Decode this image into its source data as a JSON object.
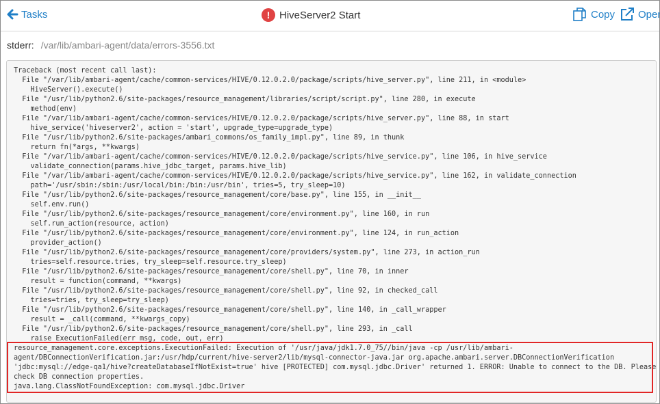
{
  "header": {
    "back_label": "Tasks",
    "title": "HiveServer2 Start",
    "copy_label": "Copy",
    "open_label": "Open"
  },
  "stderr": {
    "label": "stderr:",
    "path": "/var/lib/ambari-agent/data/errors-3556.txt"
  },
  "log_text": "Traceback (most recent call last):\n  File \"/var/lib/ambari-agent/cache/common-services/HIVE/0.12.0.2.0/package/scripts/hive_server.py\", line 211, in <module>\n    HiveServer().execute()\n  File \"/usr/lib/python2.6/site-packages/resource_management/libraries/script/script.py\", line 280, in execute\n    method(env)\n  File \"/var/lib/ambari-agent/cache/common-services/HIVE/0.12.0.2.0/package/scripts/hive_server.py\", line 88, in start\n    hive_service('hiveserver2', action = 'start', upgrade_type=upgrade_type)\n  File \"/usr/lib/python2.6/site-packages/ambari_commons/os_family_impl.py\", line 89, in thunk\n    return fn(*args, **kwargs)\n  File \"/var/lib/ambari-agent/cache/common-services/HIVE/0.12.0.2.0/package/scripts/hive_service.py\", line 106, in hive_service\n    validate_connection(params.hive_jdbc_target, params.hive_lib)\n  File \"/var/lib/ambari-agent/cache/common-services/HIVE/0.12.0.2.0/package/scripts/hive_service.py\", line 162, in validate_connection\n    path='/usr/sbin:/sbin:/usr/local/bin:/bin:/usr/bin', tries=5, try_sleep=10)\n  File \"/usr/lib/python2.6/site-packages/resource_management/core/base.py\", line 155, in __init__\n    self.env.run()\n  File \"/usr/lib/python2.6/site-packages/resource_management/core/environment.py\", line 160, in run\n    self.run_action(resource, action)\n  File \"/usr/lib/python2.6/site-packages/resource_management/core/environment.py\", line 124, in run_action\n    provider_action()\n  File \"/usr/lib/python2.6/site-packages/resource_management/core/providers/system.py\", line 273, in action_run\n    tries=self.resource.tries, try_sleep=self.resource.try_sleep)\n  File \"/usr/lib/python2.6/site-packages/resource_management/core/shell.py\", line 70, in inner\n    result = function(command, **kwargs)\n  File \"/usr/lib/python2.6/site-packages/resource_management/core/shell.py\", line 92, in checked_call\n    tries=tries, try_sleep=try_sleep)\n  File \"/usr/lib/python2.6/site-packages/resource_management/core/shell.py\", line 140, in _call_wrapper\n    result = _call(command, **kwargs_copy)\n  File \"/usr/lib/python2.6/site-packages/resource_management/core/shell.py\", line 293, in _call\n    raise ExecutionFailed(err_msg, code, out, err)\nresource_management.core.exceptions.ExecutionFailed: Execution of '/usr/java/jdk1.7.0_75//bin/java -cp /usr/lib/ambari-\nagent/DBConnectionVerification.jar:/usr/hdp/current/hive-server2/lib/mysql-connector-java.jar org.apache.ambari.server.DBConnectionVerification\n'jdbc:mysql://edge-qa1/hive?createDatabaseIfNotExist=true' hive [PROTECTED] com.mysql.jdbc.Driver' returned 1. ERROR: Unable to connect to the DB. Please\ncheck DB connection properties.\njava.lang.ClassNotFoundException: com.mysql.jdbc.Driver",
  "colors": {
    "link": "#1f7fc7",
    "error_icon": "#e04343",
    "highlight_border": "#e12626",
    "log_background": "#f6f6f6"
  },
  "icons": {
    "back": "arrow-left-icon",
    "status": "error-icon",
    "copy": "copy-icon",
    "open": "external-link-icon"
  }
}
